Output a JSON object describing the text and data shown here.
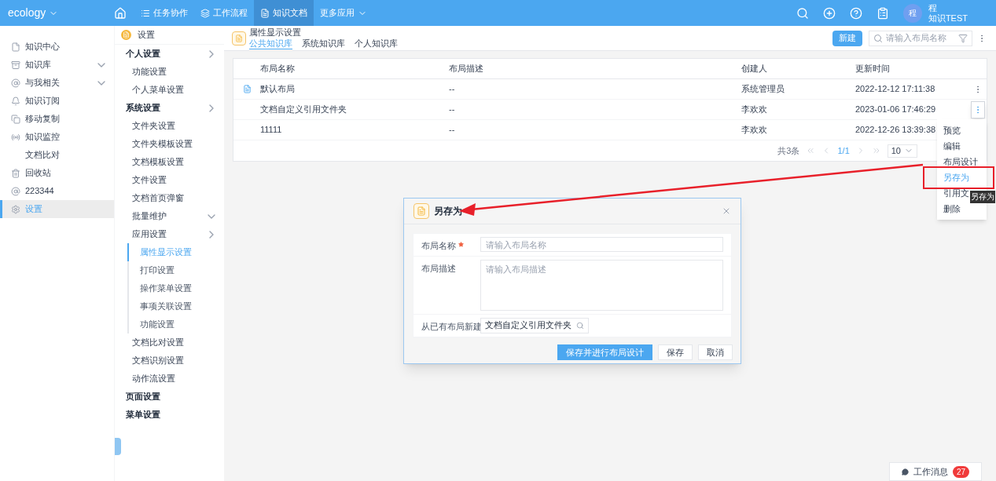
{
  "topbar": {
    "brand": "ecology",
    "nav": [
      {
        "label": "任务协作",
        "selected": false
      },
      {
        "label": "工作流程",
        "selected": false
      },
      {
        "label": "知识文档",
        "selected": true
      },
      {
        "label": "更多应用",
        "selected": false
      }
    ],
    "user": {
      "avatar": "程",
      "name": "程",
      "org": "知识TEST"
    }
  },
  "sidebar": {
    "items": [
      {
        "label": "知识中心",
        "expandable": false,
        "selected": false
      },
      {
        "label": "知识库",
        "expandable": true,
        "selected": false
      },
      {
        "label": "与我相关",
        "expandable": true,
        "selected": false
      },
      {
        "label": "知识订阅",
        "expandable": false,
        "selected": false
      },
      {
        "label": "移动复制",
        "expandable": false,
        "selected": false
      },
      {
        "label": "知识监控",
        "expandable": false,
        "selected": false
      },
      {
        "label": "文档比对",
        "expandable": false,
        "selected": false
      },
      {
        "label": "回收站",
        "expandable": false,
        "selected": false
      },
      {
        "label": "223344",
        "expandable": false,
        "selected": false
      },
      {
        "label": "设置",
        "expandable": false,
        "selected": true
      }
    ]
  },
  "settings_tree": {
    "title": "设置",
    "items": [
      {
        "label": "个人设置",
        "expanded": false,
        "children": [
          {
            "label": "功能设置"
          },
          {
            "label": "个人菜单设置"
          }
        ]
      },
      {
        "label": "系统设置",
        "expanded": false,
        "children": [
          {
            "label": "文件夹设置"
          },
          {
            "label": "文件夹模板设置"
          },
          {
            "label": "文档模板设置"
          },
          {
            "label": "文件设置"
          },
          {
            "label": "文档首页弹窗"
          },
          {
            "label": "批量维护",
            "expanded": true
          },
          {
            "label": "应用设置",
            "expanded": false,
            "children": [
              {
                "label": "属性显示设置",
                "selected": true
              },
              {
                "label": "打印设置",
                "selected": false
              },
              {
                "label": "操作菜单设置",
                "selected": false
              },
              {
                "label": "事项关联设置",
                "selected": false
              },
              {
                "label": "功能设置",
                "selected": false
              }
            ]
          },
          {
            "label": "文档比对设置"
          },
          {
            "label": "文档识别设置"
          },
          {
            "label": "动作流设置"
          }
        ]
      },
      {
        "label": "页面设置"
      },
      {
        "label": "菜单设置"
      }
    ]
  },
  "page": {
    "title": "属性显示设置",
    "tabs": [
      {
        "label": "公共知识库",
        "selected": true
      },
      {
        "label": "系统知识库",
        "selected": false
      },
      {
        "label": "个人知识库",
        "selected": false
      }
    ],
    "new_button": "新建",
    "search": {
      "placeholder": "请输入布局名称"
    }
  },
  "table": {
    "columns": [
      "布局名称",
      "布局描述",
      "创建人",
      "更新时间"
    ],
    "rows": [
      {
        "cells": [
          "默认布局",
          "--",
          "系统管理员",
          "2022-12-12 17:11:38"
        ],
        "marked": true,
        "menu_open": false
      },
      {
        "cells": [
          "文档自定义引用文件夹",
          "--",
          "李欢欢",
          "2023-01-06 17:46:29"
        ],
        "marked": false,
        "menu_open": true
      },
      {
        "cells": [
          "11111",
          "--",
          "李欢欢",
          "2022-12-26 13:39:38"
        ],
        "marked": false
      }
    ],
    "pagination": {
      "total": "共3条",
      "page": "1/1",
      "page_size": "10"
    }
  },
  "row_menu": {
    "items": [
      {
        "label": "预览",
        "selected": false
      },
      {
        "label": "编辑",
        "selected": false
      },
      {
        "label": "布局设计",
        "selected": false
      },
      {
        "label": "另存为",
        "selected": true
      },
      {
        "label": "引用文",
        "selected": false
      },
      {
        "label": "删除",
        "selected": false
      }
    ],
    "tooltip": "另存为"
  },
  "dialog": {
    "title": "另存为",
    "fields": [
      {
        "label": "布局名称",
        "required": true,
        "kind": "input",
        "placeholder": "请输入布局名称"
      },
      {
        "label": "布局描述",
        "kind": "textarea",
        "placeholder": "请输入布局描述"
      },
      {
        "label": "从已有布局新建",
        "kind": "browse",
        "value": "文档自定义引用文件夹"
      }
    ],
    "buttons": [
      {
        "label": "保存并进行布局设计",
        "kind": "primary"
      },
      {
        "label": "保存",
        "kind": "default"
      },
      {
        "label": "取消",
        "kind": "default"
      }
    ]
  },
  "message_bar": {
    "label": "工作消息",
    "count": "27"
  }
}
